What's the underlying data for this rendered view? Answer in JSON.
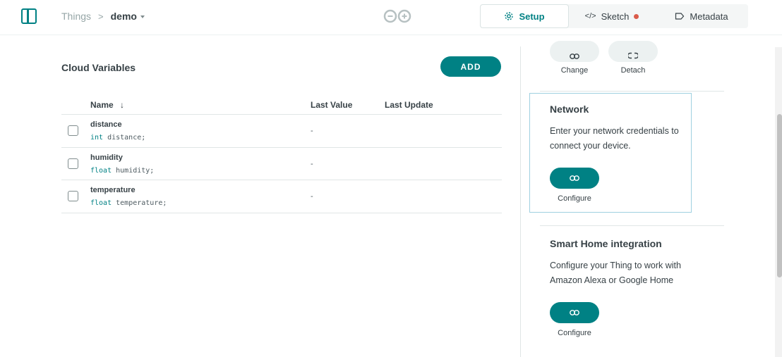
{
  "header": {
    "breadcrumb_root": "Things",
    "breadcrumb_separator": ">",
    "breadcrumb_current": "demo",
    "tabs": [
      {
        "label": "Setup",
        "icon": "gear-icon",
        "active": true
      },
      {
        "label": "Sketch",
        "icon": "code-icon",
        "active": false,
        "has_unsaved": true
      },
      {
        "label": "Metadata",
        "icon": "tag-icon",
        "active": false
      }
    ]
  },
  "variables": {
    "title": "Cloud Variables",
    "add_label": "ADD",
    "columns": {
      "name": "Name",
      "sort_arrow": "↓",
      "last_value": "Last Value",
      "last_update": "Last Update"
    },
    "rows": [
      {
        "name": "distance",
        "type": "int",
        "decl": " distance;",
        "last_value": "-",
        "last_update": ""
      },
      {
        "name": "humidity",
        "type": "float",
        "decl": " humidity;",
        "last_value": "-",
        "last_update": ""
      },
      {
        "name": "temperature",
        "type": "float",
        "decl": " temperature;",
        "last_value": "-",
        "last_update": ""
      }
    ]
  },
  "device": {
    "change_label": "Change",
    "detach_label": "Detach"
  },
  "network": {
    "title": "Network",
    "description": "Enter your network credentials to connect your device.",
    "configure_label": "Configure"
  },
  "smart_home": {
    "title": "Smart Home integration",
    "description": "Configure your Thing to work with Amazon Alexa or Google Home",
    "configure_label": "Configure"
  },
  "colors": {
    "accent": "#008184",
    "unsaved_dot": "#da5b4a",
    "highlight_border": "#9fd0e0"
  }
}
